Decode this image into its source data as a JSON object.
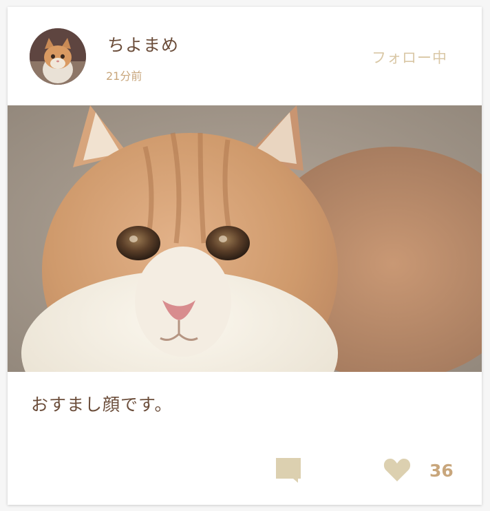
{
  "post": {
    "user": {
      "name": "ちよまめ",
      "time": "21分前",
      "follow_label": "フォロー中"
    },
    "photo_subject": "cat-photo",
    "caption": "おすまし顔です。",
    "actions": {
      "comment_icon": "comment-icon",
      "like_icon": "heart-icon",
      "like_count": "36"
    }
  },
  "colors": {
    "text_brown": "#6b4d3a",
    "accent_tan": "#c8a67c",
    "icon_beige": "#dcd0b0",
    "follow_beige": "#d9c7a5"
  }
}
